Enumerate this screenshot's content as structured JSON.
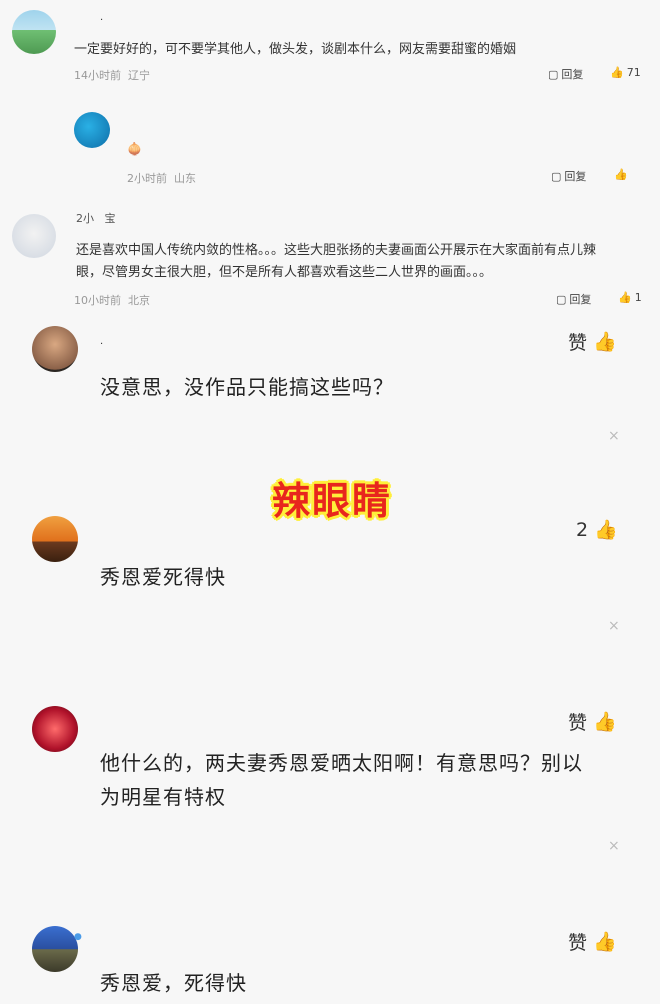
{
  "comments": [
    {
      "text": "一定要好好的，可不要学其他人，做头发，谈剧本什么，网友需要甜蜜的婚姻",
      "time": "14小时前",
      "loc": "辽宁",
      "reply": "回复",
      "likes": "71"
    },
    {
      "text": "",
      "time": "2小时前",
      "loc": "山东",
      "reply": "回复",
      "likes": ""
    },
    {
      "name": "2小   宝",
      "text_line1": "还是喜欢中国人传统内敛的性格。。。这些大胆张扬的夫妻画面公开展示在大家面前有点儿辣",
      "text_line2": "眼，尽管男女主很大胆，但不是所有人都喜欢看这些二人世界的画面。。。",
      "time": "10小时前",
      "loc": "北京",
      "reply": "回复",
      "likes": "1"
    }
  ],
  "big_comments": [
    {
      "name": ".",
      "text": "没意思，没作品只能搞这些吗？",
      "like_label": "赞"
    },
    {
      "text": "秀恩爱死得快",
      "like_count": "2"
    },
    {
      "text_line1": "他什么的，两夫妻秀恩爱晒太阳啊！有意思吗？别以",
      "text_line2": "为明星有特权",
      "like_label": "赞"
    },
    {
      "text": "秀恩爱，死得快",
      "like_label": "赞"
    }
  ],
  "overlay_text": "辣眼睛",
  "close_glyph": "×"
}
